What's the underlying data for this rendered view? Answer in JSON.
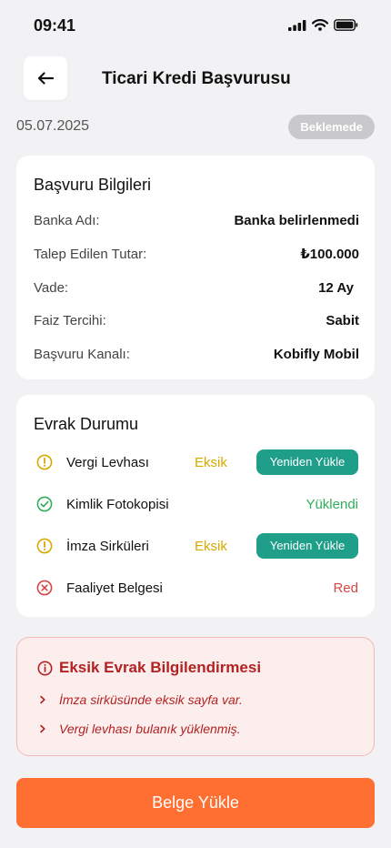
{
  "status_bar": {
    "time": "09:41"
  },
  "header": {
    "title": "Ticari Kredi Başvurusu"
  },
  "application": {
    "date": "05.07.2025",
    "status": "Beklemede"
  },
  "info_card": {
    "title": "Başvuru Bilgileri",
    "rows": [
      {
        "label": "Banka Adı:",
        "value": "Banka belirlenmedi"
      },
      {
        "label": "Talep Edilen Tutar:",
        "value": "₺100.000"
      },
      {
        "label": "Vade:",
        "value": "12 Ay"
      },
      {
        "label": "Faiz Tercihi:",
        "value": "Sabit"
      },
      {
        "label": "Başvuru Kanalı:",
        "value": "Kobifly Mobil"
      }
    ]
  },
  "docs_card": {
    "title": "Evrak Durumu",
    "reupload_label": "Yeniden Yükle",
    "docs": [
      {
        "name": "Vergi Levhası",
        "status": "Eksik",
        "icon": "warning-icon"
      },
      {
        "name": "Kimlik Fotokopisi",
        "status": "Yüklendi",
        "icon": "check-circle-icon"
      },
      {
        "name": "İmza Sirküleri",
        "status": "Eksik",
        "icon": "warning-icon"
      },
      {
        "name": "Faaliyet Belgesi",
        "status": "Red",
        "icon": "x-circle-icon"
      }
    ]
  },
  "warning": {
    "title": "Eksik Evrak Bilgilendirmesi",
    "items": [
      "İmza sirküsünde eksik sayfa var.",
      "Vergi levhası bulanık yüklenmiş."
    ]
  },
  "primary_action": {
    "label": "Belge Yükle"
  },
  "colors": {
    "accent": "#ff6f31",
    "teal": "#1f9e8a",
    "missing": "#d9a800",
    "uploaded": "#2fae5b",
    "rejected": "#d64545"
  }
}
